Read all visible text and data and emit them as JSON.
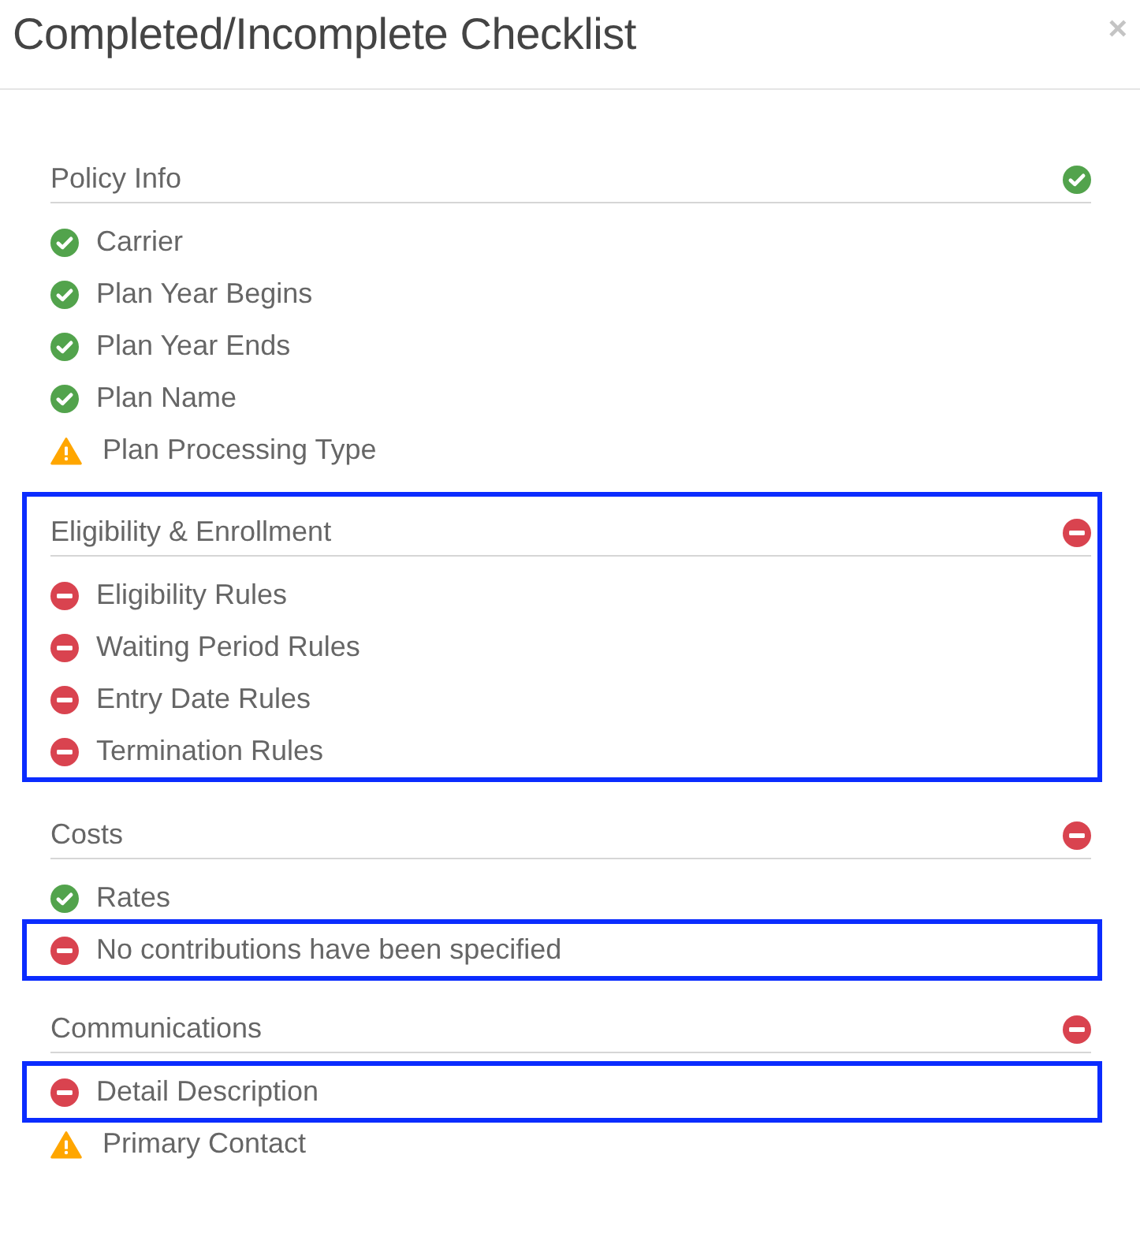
{
  "dialog": {
    "title": "Completed/Incomplete Checklist",
    "close_label": "×"
  },
  "sections": [
    {
      "title": "Policy Info",
      "kind": "complete",
      "highlighted": false,
      "items": [
        {
          "label": "Carrier",
          "kind": "complete",
          "highlighted": false
        },
        {
          "label": "Plan Year Begins",
          "kind": "complete",
          "highlighted": false
        },
        {
          "label": "Plan Year Ends",
          "kind": "complete",
          "highlighted": false
        },
        {
          "label": "Plan Name",
          "kind": "complete",
          "highlighted": false
        },
        {
          "label": "Plan Processing Type",
          "kind": "warning",
          "highlighted": false
        }
      ]
    },
    {
      "title": "Eligibility & Enrollment",
      "kind": "incomplete",
      "highlighted": true,
      "items": [
        {
          "label": "Eligibility Rules",
          "kind": "incomplete",
          "highlighted": false
        },
        {
          "label": "Waiting Period Rules",
          "kind": "incomplete",
          "highlighted": false
        },
        {
          "label": "Entry Date Rules",
          "kind": "incomplete",
          "highlighted": false
        },
        {
          "label": "Termination Rules",
          "kind": "incomplete",
          "highlighted": false
        }
      ]
    },
    {
      "title": "Costs",
      "kind": "incomplete",
      "highlighted": false,
      "items": [
        {
          "label": "Rates",
          "kind": "complete",
          "highlighted": false
        },
        {
          "label": "No contributions have been specified",
          "kind": "incomplete",
          "highlighted": true
        }
      ]
    },
    {
      "title": "Communications",
      "kind": "incomplete",
      "highlighted": false,
      "items": [
        {
          "label": "Detail Description",
          "kind": "incomplete",
          "highlighted": true
        },
        {
          "label": "Primary Contact",
          "kind": "warning",
          "highlighted": false
        }
      ]
    }
  ]
}
